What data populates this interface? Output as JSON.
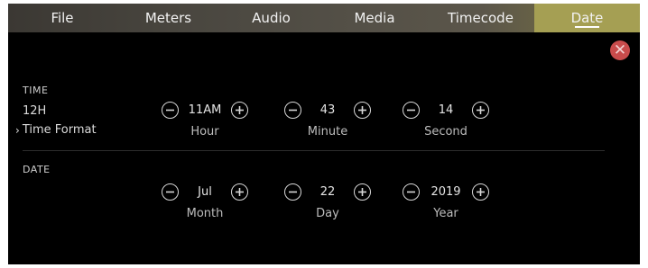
{
  "tabs": [
    {
      "label": "File"
    },
    {
      "label": "Meters"
    },
    {
      "label": "Audio"
    },
    {
      "label": "Media"
    },
    {
      "label": "Timecode"
    },
    {
      "label": "Date"
    }
  ],
  "active_tab": "Date",
  "close": {
    "glyph": "✕"
  },
  "time_section": {
    "title": "TIME",
    "format_value": "12H",
    "format_link": "Time Format",
    "steppers": [
      {
        "label": "Hour",
        "value": "11AM"
      },
      {
        "label": "Minute",
        "value": "43"
      },
      {
        "label": "Second",
        "value": "14"
      }
    ]
  },
  "date_section": {
    "title": "DATE",
    "steppers": [
      {
        "label": "Month",
        "value": "Jul"
      },
      {
        "label": "Day",
        "value": "22"
      },
      {
        "label": "Year",
        "value": "2019"
      }
    ]
  },
  "colors": {
    "active_tab": "#a59f53",
    "close": "#c94c4c",
    "background": "#000000"
  }
}
